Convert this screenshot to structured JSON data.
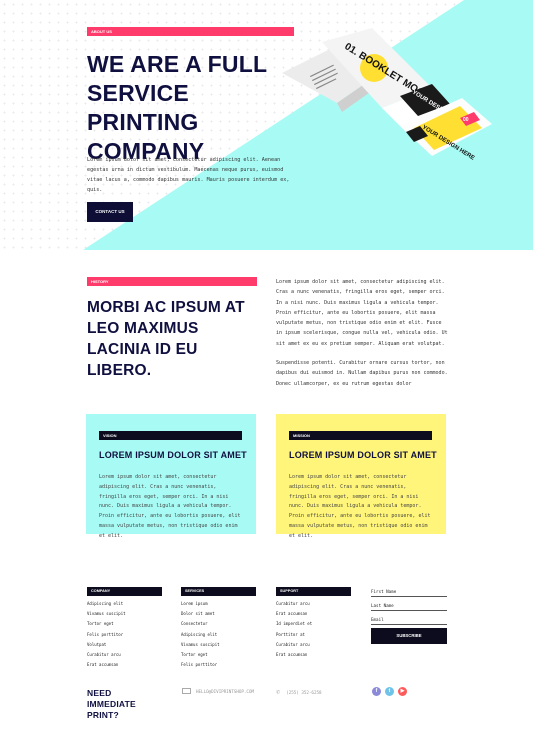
{
  "hero": {
    "tag": "ABOUT US",
    "title": "WE ARE A FULL SERVICE PRINTING COMPANY",
    "body": "Lorem ipsum dolor sit amet, consectetur adipiscing elit. Aenean egestas urna in dictum vestibulum. Maecenas neque purus, euismod vitae lacus a, commodo dapibus mauris. Mauris posuere interdum ex, quis.",
    "button": "CONTACT US",
    "booklet": {
      "cover_title": "01. BOOKLET MOCKUP",
      "page_text": "YOUR DESIGN HERE",
      "page_number": "00",
      "colors": {
        "accent": "#a8fbf4",
        "yellow": "#ffe032",
        "pink": "#ff3b6b",
        "dark": "#1a1a1a"
      }
    }
  },
  "history": {
    "tag": "HISTORY",
    "title": "MORBI AC IPSUM AT LEO MAXIMUS LACINIA ID EU LIBERO.",
    "para1": "Lorem ipsum dolor sit amet, consectetur adipiscing elit. Cras a nunc venenatis, fringilla eros eget, semper orci. In a nisi nunc. Duis maximus ligula a vehicula tempor. Proin efficitur, ante eu lobortis posuere, elit massa vulputate metus, non tristique odio enim et elit. Fusce in ipsum scelerisque, congue nulla vel, vehicula odio. Ut sit amet ex eu ex pretium semper. Aliquam erat volutpat.",
    "para2": "Suspendisse potenti. Curabitur ornare cursus tortor, non dapibus dui euismod in. Nullam dapibus purus non commodo. Donec ullamcorper, ex eu rutrum egestas dolor"
  },
  "cards": [
    {
      "tag": "VISION",
      "title": "LOREM IPSUM DOLOR SIT AMET",
      "body": "Lorem ipsum dolor sit amet, consectetur adipiscing elit. Cras a nunc venenatis, fringilla eros eget, semper orci. In a nisi nunc. Duis maximus ligula a vehicula tempor. Proin efficitur, ante eu lobortis posuere, elit massa vulputate metus, non tristique odio enim et elit.",
      "color": "#a8fbf4"
    },
    {
      "tag": "MISSION",
      "title": "LOREM IPSUM DOLOR SIT AMET",
      "body": "Lorem ipsum dolor sit amet, consectetur adipiscing elit. Cras a nunc venenatis, fringilla eros eget, semper orci. In a nisi nunc. Duis maximus ligula a vehicula tempor. Proin efficitur, ante eu lobortis posuere, elit massa vulputate metus, non tristique odio enim et elit.",
      "color": "#fff57a"
    }
  ],
  "footer": {
    "columns": [
      {
        "title": "COMPANY",
        "links": [
          "Adipiscing elit",
          "Vivamus suscipit",
          "Tortor eget",
          "Felis porttitor",
          "Volutpat",
          "Curabitur arcu",
          "Erat accumsan"
        ]
      },
      {
        "title": "SERVICES",
        "links": [
          "Lorem ipsum",
          "Dolor sit amet",
          "Consectetur",
          "Adipiscing elit",
          "Vivamus suscipit",
          "Tortor eget",
          "Felis porttitor"
        ]
      },
      {
        "title": "SUPPORT",
        "links": [
          "Curabitur arcu",
          "Erat accumsan",
          "Id imperdiet et",
          "Porttitor at",
          "Curabitur arcu",
          "Erat accumsan"
        ]
      }
    ],
    "form": {
      "first_name": "First Name",
      "last_name": "Last Name",
      "email": "Email",
      "button": "SUBSCRIBE"
    },
    "cta": "NEED IMMEDIATE PRINT?",
    "email_text": "HELLO@DIVIPRINTSHOP.COM",
    "phone_text": "(255) 352-6258",
    "socials": [
      {
        "name": "facebook-icon",
        "glyph": "f",
        "color": "#8a8ad8"
      },
      {
        "name": "twitter-icon",
        "glyph": "t",
        "color": "#6fc3e8"
      },
      {
        "name": "youtube-icon",
        "glyph": "▶",
        "color": "#ff5a5a"
      }
    ]
  }
}
